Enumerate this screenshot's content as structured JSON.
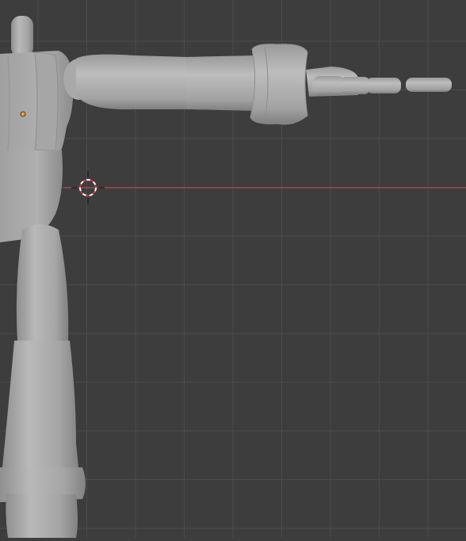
{
  "viewport": {
    "background": "#3d3d3d",
    "grid_color": "#4d4d4d",
    "x_axis_color": "#b3434e",
    "mesh_color": "#ababab",
    "mesh_shadow": "#8a8a8a",
    "origin_color": "#ff9a2a"
  },
  "objects": {
    "model": "mannequin-mesh",
    "cursor": "3d-cursor-icon",
    "origin": "object-origin-dot"
  }
}
